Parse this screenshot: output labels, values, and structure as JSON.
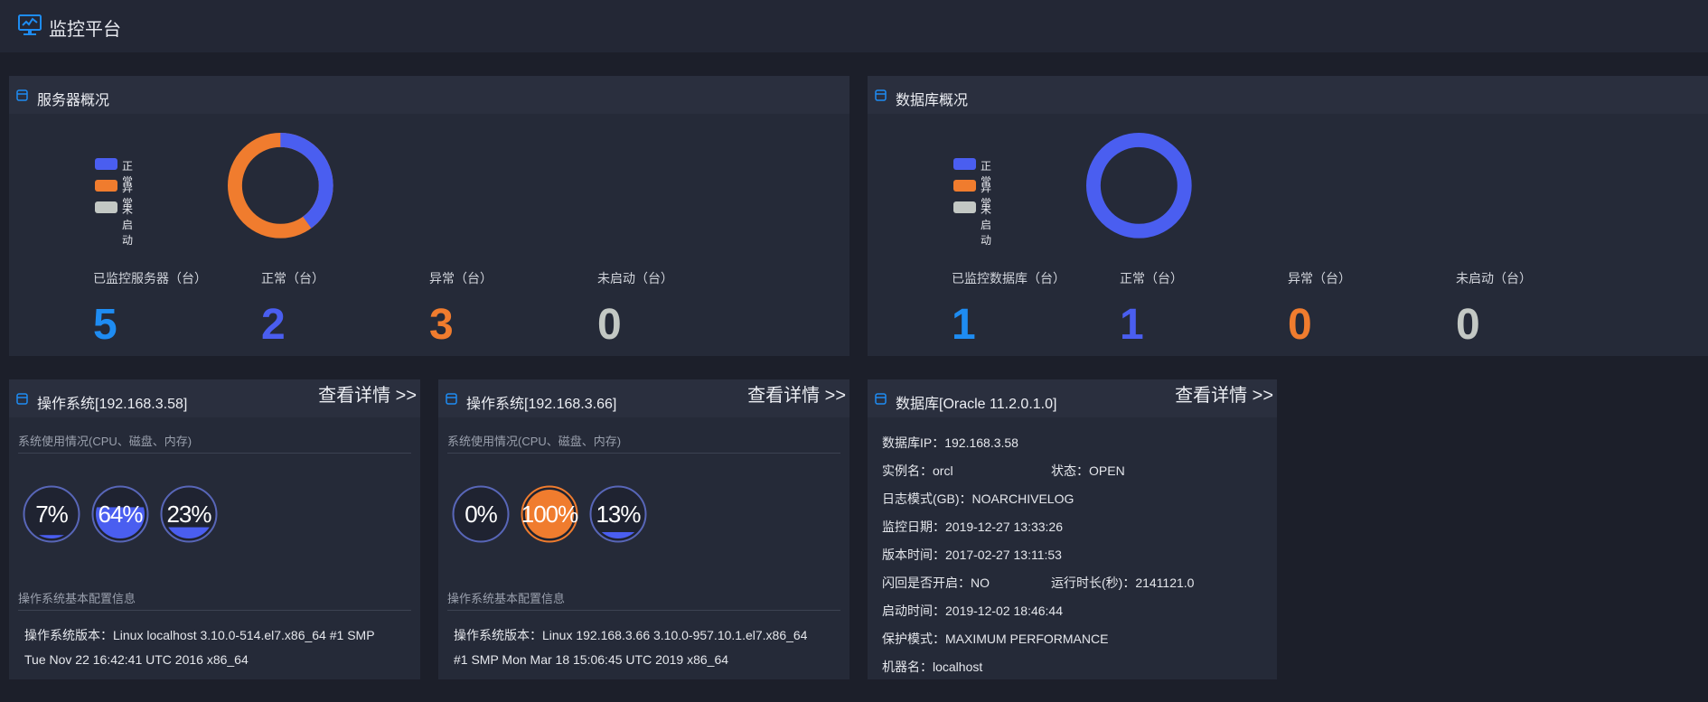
{
  "app": {
    "title": "监控平台",
    "logo_icon": "monitor-chart-icon"
  },
  "legend": {
    "normal": {
      "label": "正常",
      "color": "#4a5ef0"
    },
    "abnormal": {
      "label": "异常",
      "color": "#f07c2e"
    },
    "stopped": {
      "label": "未启动",
      "color": "#c3c8c4"
    }
  },
  "server_overview": {
    "title": "服务器概况",
    "stats": [
      {
        "label": "已监控服务器（台）",
        "value": "5",
        "color": "#1e8cf2"
      },
      {
        "label": "正常（台）",
        "value": "2",
        "color": "#4a5ef0"
      },
      {
        "label": "异常（台）",
        "value": "3",
        "color": "#f07c2e"
      },
      {
        "label": "未启动（台）",
        "value": "0",
        "color": "#c3c8c4"
      }
    ]
  },
  "db_overview": {
    "title": "数据库概况",
    "stats": [
      {
        "label": "已监控数据库（台）",
        "value": "1",
        "color": "#1e8cf2"
      },
      {
        "label": "正常（台）",
        "value": "1",
        "color": "#4a5ef0"
      },
      {
        "label": "异常（台）",
        "value": "0",
        "color": "#f07c2e"
      },
      {
        "label": "未启动（台）",
        "value": "0",
        "color": "#c3c8c4"
      }
    ]
  },
  "os_panels": [
    {
      "title": "操作系统[192.168.3.58]",
      "more": "查看详情 >>",
      "usage_title": "系统使用情况(CPU、磁盘、内存)",
      "gauges": [
        {
          "label": "7%",
          "value": 7
        },
        {
          "label": "64%",
          "value": 64
        },
        {
          "label": "23%",
          "value": 23
        }
      ],
      "config_title": "操作系统基本配置信息",
      "version_line1": "操作系统版本：Linux localhost 3.10.0-514.el7.x86_64 #1 SMP",
      "version_line2": "Tue Nov 22 16:42:41 UTC 2016 x86_64"
    },
    {
      "title": "操作系统[192.168.3.66]",
      "more": "查看详情 >>",
      "usage_title": "系统使用情况(CPU、磁盘、内存)",
      "gauges": [
        {
          "label": "0%",
          "value": 0
        },
        {
          "label": "100%",
          "value": 100
        },
        {
          "label": "13%",
          "value": 13
        }
      ],
      "config_title": "操作系统基本配置信息",
      "version_line1": "操作系统版本：Linux 192.168.3.66 3.10.0-957.10.1.el7.x86_64",
      "version_line2": "#1 SMP Mon Mar 18 15:06:45 UTC 2019 x86_64"
    }
  ],
  "db_panel": {
    "title": "数据库[Oracle 11.2.0.1.0]",
    "more": "查看详情 >>",
    "ip": "数据库IP：192.168.3.58",
    "instance": "实例名：orcl",
    "status": "状态：OPEN",
    "log_mode": "日志模式(GB)：NOARCHIVELOG",
    "monitor_date": "监控日期：2019-12-27 13:33:26",
    "version_time": "版本时间：2017-02-27 13:11:53",
    "flashback": "闪回是否开启：NO",
    "uptime": "运行时长(秒)：2141121.0",
    "start_time": "启动时间：2019-12-02 18:46:44",
    "protection": "保护模式：MAXIMUM PERFORMANCE",
    "machine": "机器名：localhost"
  },
  "colors": {
    "gauge_ring": "#5866b8",
    "gauge_fill": "#4a5ef0",
    "gauge_hot": "#f07c2e"
  }
}
